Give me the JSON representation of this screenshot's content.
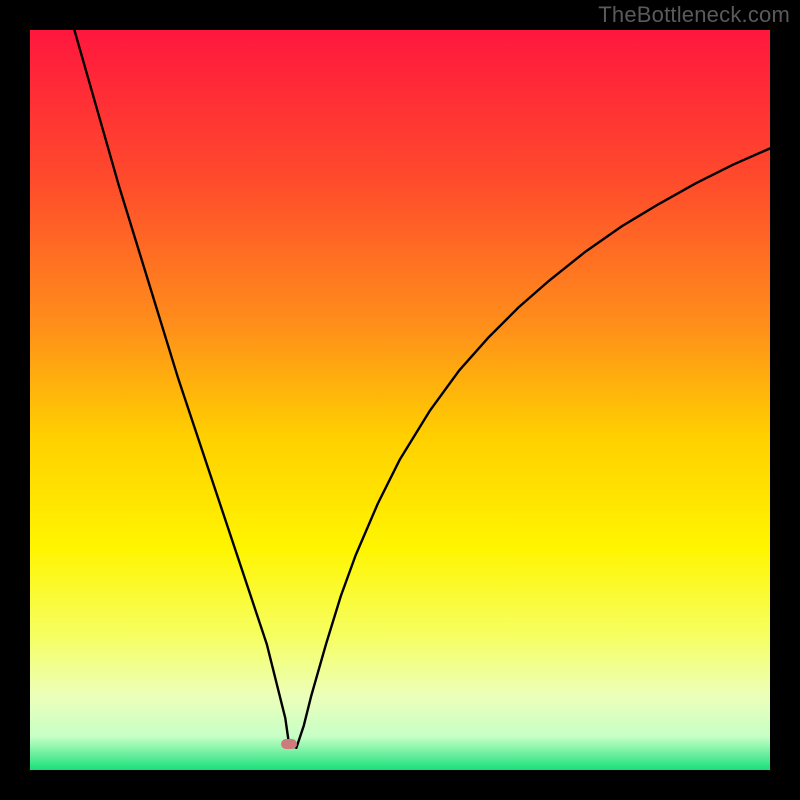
{
  "watermark": "TheBottleneck.com",
  "chart_data": {
    "type": "line",
    "title": "",
    "xlabel": "",
    "ylabel": "",
    "xlim": [
      0,
      100
    ],
    "ylim": [
      0,
      100
    ],
    "grid": false,
    "legend": false,
    "background_gradient": {
      "stops": [
        {
          "offset": 0.0,
          "color": "#ff173e"
        },
        {
          "offset": 0.2,
          "color": "#ff4a2c"
        },
        {
          "offset": 0.4,
          "color": "#ff8f1a"
        },
        {
          "offset": 0.55,
          "color": "#ffd000"
        },
        {
          "offset": 0.7,
          "color": "#fff500"
        },
        {
          "offset": 0.82,
          "color": "#f6ff63"
        },
        {
          "offset": 0.9,
          "color": "#ecffba"
        },
        {
          "offset": 0.955,
          "color": "#c6ffc6"
        },
        {
          "offset": 1.0,
          "color": "#18e07a"
        }
      ]
    },
    "series": [
      {
        "name": "bottleneck-curve",
        "stroke": "#000000",
        "x": [
          6,
          8,
          10,
          12,
          14,
          16,
          18,
          20,
          22,
          24,
          26,
          28,
          30,
          32,
          33.5,
          34.5,
          35,
          36,
          37,
          38,
          40,
          42,
          44,
          47,
          50,
          54,
          58,
          62,
          66,
          70,
          75,
          80,
          85,
          90,
          95,
          100
        ],
        "y": [
          100,
          93,
          86,
          79,
          72.5,
          66,
          59.5,
          53,
          47,
          41,
          35,
          29,
          23,
          17,
          11,
          7,
          3.5,
          3,
          6,
          10,
          17,
          23.5,
          29,
          36,
          42,
          48.5,
          54,
          58.5,
          62.5,
          66,
          70,
          73.5,
          76.5,
          79.3,
          81.8,
          84
        ]
      }
    ],
    "marker": {
      "name": "optimal-point",
      "x": 35,
      "y": 3.5,
      "color": "#cf7b7b"
    }
  }
}
